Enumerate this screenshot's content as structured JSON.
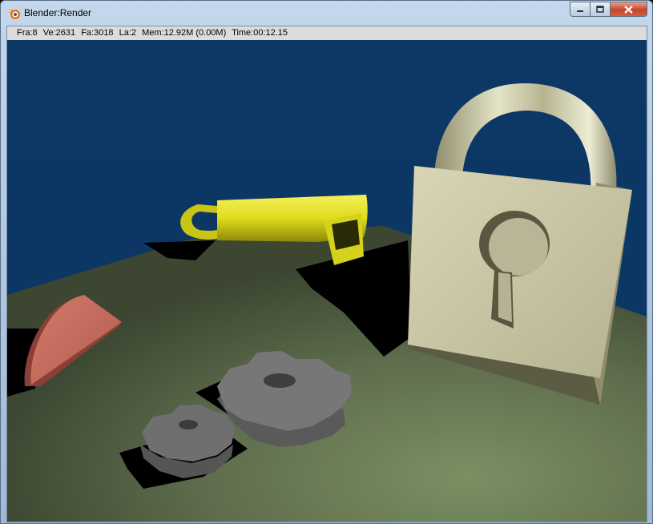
{
  "window": {
    "title": "Blender:Render",
    "icon": "blender-logo-icon",
    "buttons": {
      "minimize": "minimize-icon",
      "maximize": "maximize-icon",
      "close": "close-icon"
    }
  },
  "status": {
    "frame": "Fra:8",
    "vertices": "Ve:2631",
    "faces": "Fa:3018",
    "lamps": "La:2",
    "memory": "Mem:12.92M (0.00M)",
    "time": "Time:00:12.15"
  },
  "colors": {
    "sky": "#0e3a66",
    "ground": "#5f6f4e",
    "padlock": "#c9c7a2",
    "key": "#e3df1e",
    "half_disc": "#c66a5b",
    "gears": "#717171"
  }
}
